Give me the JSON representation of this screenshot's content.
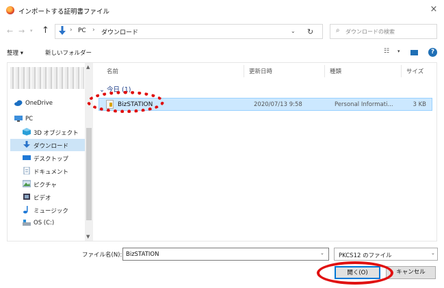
{
  "window": {
    "title": "インポートする証明書ファイル",
    "close_glyph": "×"
  },
  "nav": {
    "back_glyph": "←",
    "forward_glyph": "→",
    "recent_glyph": "▾",
    "up_glyph": "↑",
    "breadcrumb": [
      "PC",
      "ダウンロード"
    ],
    "separator": "›",
    "dropdown_glyph": "⌄",
    "refresh_glyph": "↻",
    "search_glyph": "⌕",
    "search_placeholder": "ダウンロードの検索"
  },
  "toolbar": {
    "organize_label": "整理 ▾",
    "new_folder_label": "新しいフォルダー",
    "view_glyph": "☷",
    "view_chevron": "▾",
    "help_glyph": "?"
  },
  "sidebar": {
    "items": [
      {
        "label": "OneDrive",
        "icon": "cloud-icon"
      },
      {
        "label": "PC",
        "icon": "computer-icon"
      },
      {
        "label": "3D オブジェクト",
        "icon": "cube-icon"
      },
      {
        "label": "ダウンロード",
        "icon": "download-icon",
        "selected": true
      },
      {
        "label": "デスクトップ",
        "icon": "desktop-icon"
      },
      {
        "label": "ドキュメント",
        "icon": "document-icon"
      },
      {
        "label": "ピクチャ",
        "icon": "picture-icon"
      },
      {
        "label": "ビデオ",
        "icon": "video-icon"
      },
      {
        "label": "ミュージック",
        "icon": "music-icon"
      },
      {
        "label": "OS (C:)",
        "icon": "drive-icon"
      }
    ],
    "scroll_up": "▲",
    "scroll_down": "▼"
  },
  "columns": {
    "name": "名前",
    "date": "更新日時",
    "type": "種類",
    "size": "サイズ"
  },
  "group_header": "⌄ 今日 (1)",
  "files": [
    {
      "name": "BizSTATION",
      "date": "2020/07/13 9:58",
      "type": "Personal Informati...",
      "size": "3 KB"
    }
  ],
  "footer": {
    "filename_label": "ファイル名(N):",
    "filename_value": "BizSTATION",
    "filename_chevron": "⌄",
    "filetype_value": "PKCS12 のファイル",
    "filetype_chevron": "⌄",
    "open_label": "開く(O)",
    "cancel_label": "キャンセル"
  },
  "colors": {
    "accent": "#0078d7",
    "annotation": "#e01010",
    "selection": "#cce8ff"
  }
}
